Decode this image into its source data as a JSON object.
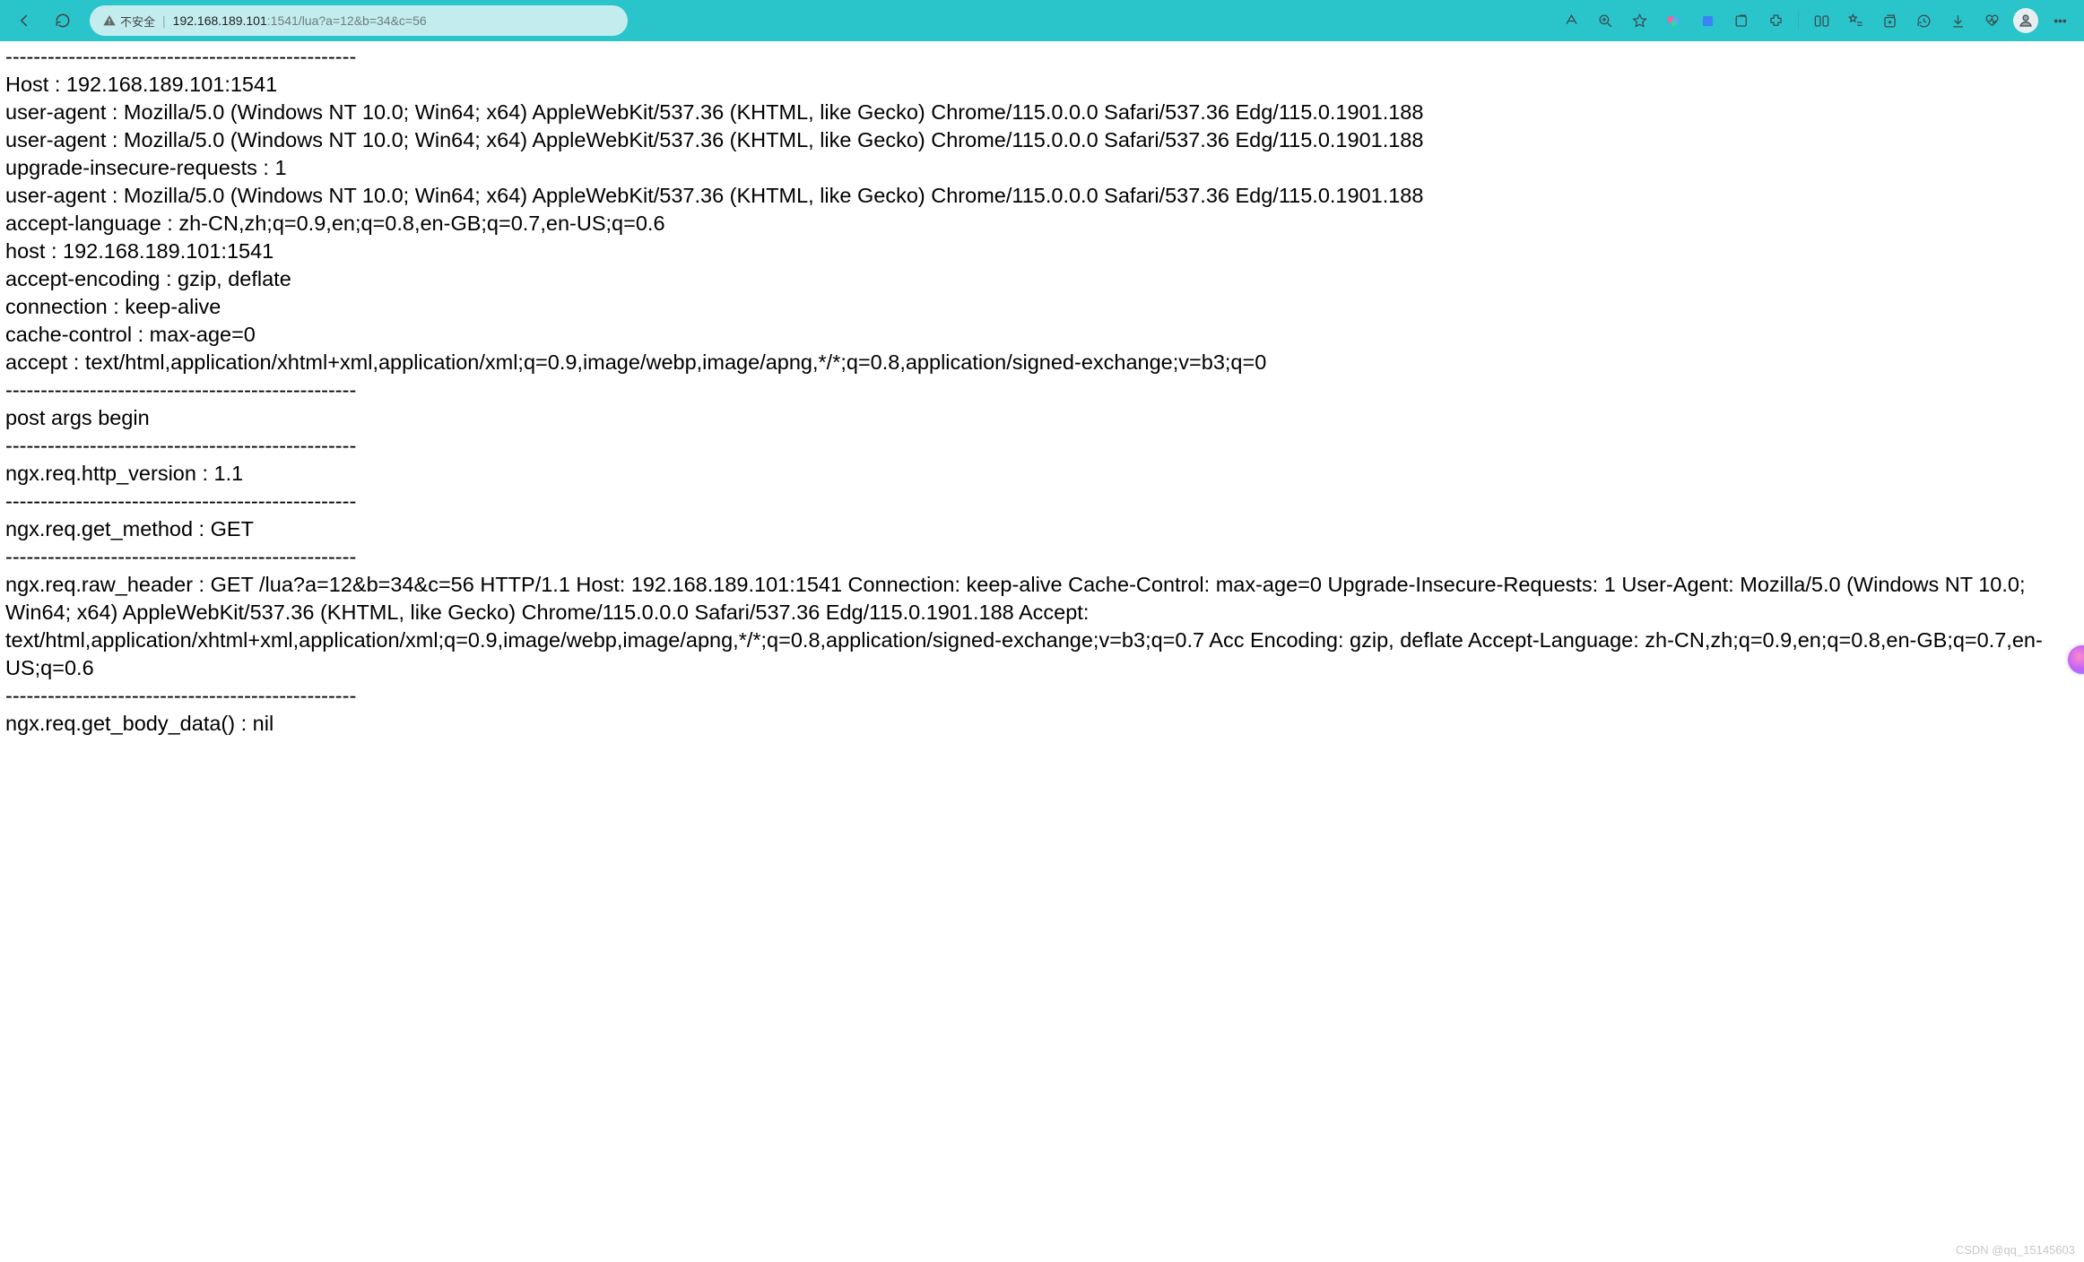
{
  "toolbar": {
    "insecure_label": "不安全",
    "url_host": "192.168.189.101",
    "url_rest": ":1541/lua?a=12&b=34&c=56"
  },
  "content_lines": [
    "--------------------------------------------------",
    "Host : 192.168.189.101:1541",
    "user-agent : Mozilla/5.0 (Windows NT 10.0; Win64; x64) AppleWebKit/537.36 (KHTML, like Gecko) Chrome/115.0.0.0 Safari/537.36 Edg/115.0.1901.188",
    "user-agent : Mozilla/5.0 (Windows NT 10.0; Win64; x64) AppleWebKit/537.36 (KHTML, like Gecko) Chrome/115.0.0.0 Safari/537.36 Edg/115.0.1901.188",
    "upgrade-insecure-requests : 1",
    "user-agent : Mozilla/5.0 (Windows NT 10.0; Win64; x64) AppleWebKit/537.36 (KHTML, like Gecko) Chrome/115.0.0.0 Safari/537.36 Edg/115.0.1901.188",
    "accept-language : zh-CN,zh;q=0.9,en;q=0.8,en-GB;q=0.7,en-US;q=0.6",
    "host : 192.168.189.101:1541",
    "accept-encoding : gzip, deflate",
    "connection : keep-alive",
    "cache-control : max-age=0",
    "accept : text/html,application/xhtml+xml,application/xml;q=0.9,image/webp,image/apng,*/*;q=0.8,application/signed-exchange;v=b3;q=0",
    "--------------------------------------------------",
    "post args begin",
    "--------------------------------------------------",
    "ngx.req.http_version : 1.1",
    "--------------------------------------------------",
    "ngx.req.get_method : GET",
    "--------------------------------------------------",
    "ngx.req.raw_header : GET /lua?a=12&b=34&c=56 HTTP/1.1 Host: 192.168.189.101:1541 Connection: keep-alive Cache-Control: max-age=0 Upgrade-Insecure-Requests: 1 User-Agent: Mozilla/5.0 (Windows NT 10.0; Win64; x64) AppleWebKit/537.36 (KHTML, like Gecko) Chrome/115.0.0.0 Safari/537.36 Edg/115.0.1901.188 Accept: text/html,application/xhtml+xml,application/xml;q=0.9,image/webp,image/apng,*/*;q=0.8,application/signed-exchange;v=b3;q=0.7 Acc Encoding: gzip, deflate Accept-Language: zh-CN,zh;q=0.9,en;q=0.8,en-GB;q=0.7,en-US;q=0.6",
    "--------------------------------------------------",
    "ngx.req.get_body_data() : nil"
  ],
  "watermark": "CSDN @qq_15145603"
}
